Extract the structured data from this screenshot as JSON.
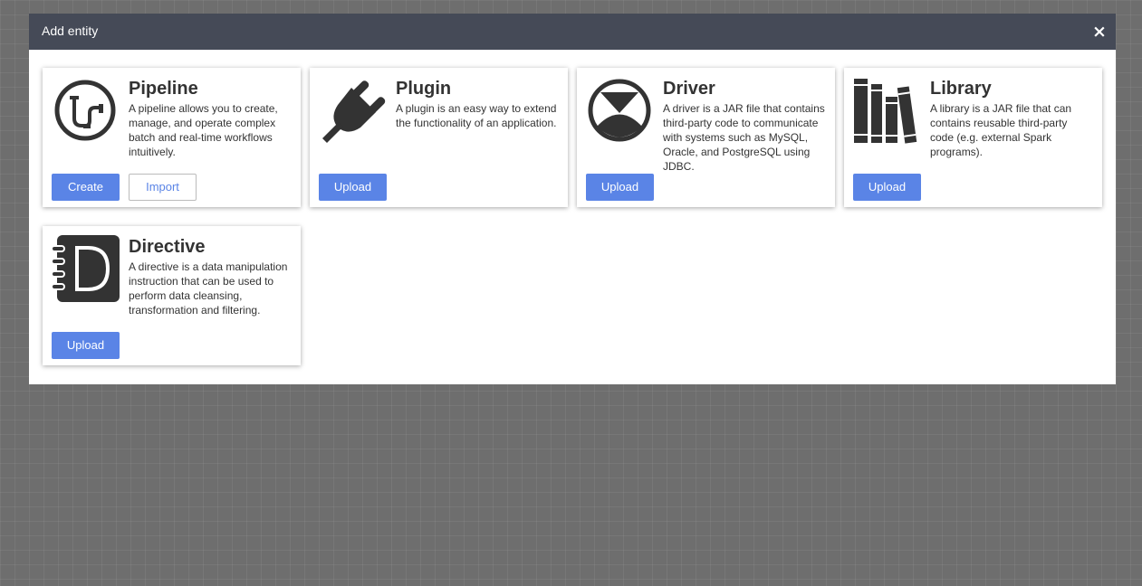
{
  "modal": {
    "title": "Add entity",
    "close_label": "×"
  },
  "cards": [
    {
      "title": "Pipeline",
      "description": "A pipeline allows you to create, manage, and operate complex batch and real-time workflows intuitively.",
      "icon": "pipeline-icon",
      "buttons": [
        "Create",
        "Import"
      ]
    },
    {
      "title": "Plugin",
      "description": "A plugin is an easy way to extend the functionality of an application.",
      "icon": "plug-icon",
      "buttons": [
        "Upload"
      ]
    },
    {
      "title": "Driver",
      "description": "A driver is a JAR file that contains third-party code to communicate with systems such as MySQL, Oracle, and PostgreSQL using JDBC.",
      "icon": "driver-icon",
      "buttons": [
        "Upload"
      ]
    },
    {
      "title": "Library",
      "description": "A library is a JAR file that can contains reusable third-party code (e.g. external Spark programs).",
      "icon": "books-icon",
      "buttons": [
        "Upload"
      ]
    },
    {
      "title": "Directive",
      "description": "A directive is a data manipulation instruction that can be used to perform data cleansing, transformation and filtering.",
      "icon": "directive-notebook-icon",
      "buttons": [
        "Upload"
      ]
    }
  ],
  "colors": {
    "header_bg": "#454a57",
    "primary_button": "#5a84e6",
    "icon_fill": "#333333"
  }
}
